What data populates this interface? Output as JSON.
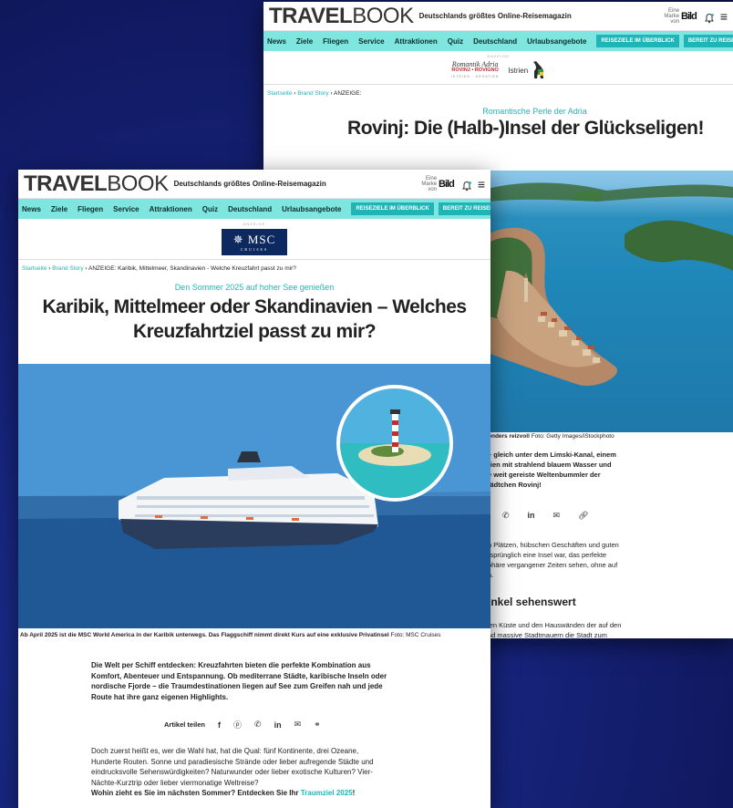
{
  "back": {
    "logo_bold": "TRAVEL",
    "logo_light": "BOOK",
    "tagline": "Deutschlands größtes Online-Reisemagazin",
    "bild_small": "Eine Marke von",
    "bild_brand": "Bild",
    "nav": [
      "News",
      "Ziele",
      "Fliegen",
      "Service",
      "Attraktionen",
      "Quiz",
      "Deutschland",
      "Urlaubsangebote"
    ],
    "btn1": "REISEZIELE IM ÜBERBLICK",
    "btn2": "BEREIT ZU REISEN",
    "anzeige": "ANZEIGE",
    "ad_logo1_line1": "Romantik Adria",
    "ad_logo1_line2": "ROVINJ • ROVIGNO",
    "ad_logo1_line3": "ISTRIEN · KROATIEN",
    "ad_logo2": "Istrien",
    "crumb_home": "Startseite",
    "crumb_sep": "›",
    "crumb_cat": "Brand Story",
    "crumb_current": "ANZEIGE:",
    "kicker": "Romantische Perle der Adria",
    "title": "Rovinj: Die (Halb-)Insel der Glückseligen!",
    "caption_bold": "onders reizvoll",
    "caption_credit": "Foto: Getty Images/iStockphoto",
    "intro": [
      "– gleich unter dem Limski-Kanal, einem",
      "rien mit strahlend blauem Wasser und",
      "e weit gereiste Weltenbummler der",
      "tädtchen Rovinj!"
    ],
    "para": [
      "n Plätzen, hübschen Geschäften und guten",
      "rsprünglich eine Insel war, das perfekte",
      "phäre vergangener Zeiten sehen, ohne auf",
      "n."
    ],
    "subhead": "inkel sehenswert",
    "para2": [
      "len Küste und den Hauswänden der auf den",
      "nd massive Stadtmauern die Stadt zum"
    ]
  },
  "front": {
    "logo_bold": "TRAVEL",
    "logo_light": "BOOK",
    "tagline": "Deutschlands größtes Online-Reisemagazin",
    "bild_small": "Eine Marke von",
    "bild_brand": "Bild",
    "nav": [
      "News",
      "Ziele",
      "Fliegen",
      "Service",
      "Attraktionen",
      "Quiz",
      "Deutschland",
      "Urlaubsangebote"
    ],
    "btn1": "REISEZIELE IM ÜBERBLICK",
    "btn2": "BEREIT ZU REISEN",
    "anzeige": "ANZEIGE",
    "msc_main": "MSC",
    "msc_sub": "CRUISES",
    "crumb_home": "Startseite",
    "crumb_sep": "›",
    "crumb_cat": "Brand Story",
    "crumb_current": "ANZEIGE: Karibik, Mittelmeer, Skandinavien - Welche Kreuzfahrt passt zu mir?",
    "kicker": "Den Sommer 2025 auf hoher See genießen",
    "title_line1": "Karibik, Mittelmeer oder Skandinavien – Welches",
    "title_line2": "Kreuzfahrtziel passt zu mir?",
    "caption_bold": "Ab April 2025 ist die MSC World America in der Karibik unterwegs. Das Flaggschiff nimmt direkt Kurs auf eine exklusive Privatinsel",
    "caption_credit": "Foto: MSC Cruises",
    "intro": [
      "Die Welt per Schiff entdecken: Kreuzfahrten bieten die perfekte Kombination aus",
      "Komfort, Abenteuer und Entspannung. Ob mediterrane Städte, karibische Inseln oder",
      "nordische Fjorde – die Traumdestinationen liegen auf See zum Greifen nah und jede",
      "Route hat ihre ganz eigenen Highlights."
    ],
    "share_label": "Artikel teilen",
    "para": [
      "Doch zuerst heißt es, wer die Wahl hat, hat die Qual: fünf Kontinente, drei Ozeane,",
      "Hunderte Routen. Sonne und paradiesische Strände oder lieber aufregende Städte und",
      "eindrucksvolle Sehenswürdigkeiten? Naturwunder oder lieber exotische Kulturen? Vier-",
      "Nächte-Kurztrip oder lieber viermonatige Weltreise?"
    ],
    "para_bold": "Wohin zieht es Sie im nächsten Sommer? Entdecken Sie Ihr ",
    "para_link": "Traumziel 2025",
    "para_end": "!"
  },
  "colors": {
    "accent": "#1fb5b8",
    "nav_bg": "#7ee6df",
    "msc_navy": "#0e2960"
  }
}
